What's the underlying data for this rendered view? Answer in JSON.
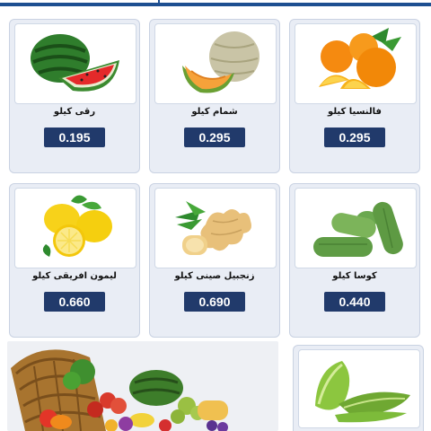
{
  "products": [
    {
      "name": "رقى كيلو",
      "price": "0.195",
      "icon": "watermelon-icon"
    },
    {
      "name": "شمام كيلو",
      "price": "0.295",
      "icon": "melon-icon"
    },
    {
      "name": "فالنسيا كيلو",
      "price": "0.295",
      "icon": "orange-icon"
    },
    {
      "name": "ليمون افريقى كيلو",
      "price": "0.660",
      "icon": "lemon-icon"
    },
    {
      "name": "زنجبيل صينى كيلو",
      "price": "0.690",
      "icon": "ginger-icon"
    },
    {
      "name": "كوسا كيلو",
      "price": "0.440",
      "icon": "zucchini-icon"
    },
    {
      "name": "",
      "price": "",
      "icon": "lettuce-icon"
    }
  ],
  "banner": {
    "icon": "fruit-basket-icon"
  },
  "colors": {
    "accent": "#1d4f91",
    "price_bg": "#213a6b",
    "card_bg": "#e9edf5"
  }
}
